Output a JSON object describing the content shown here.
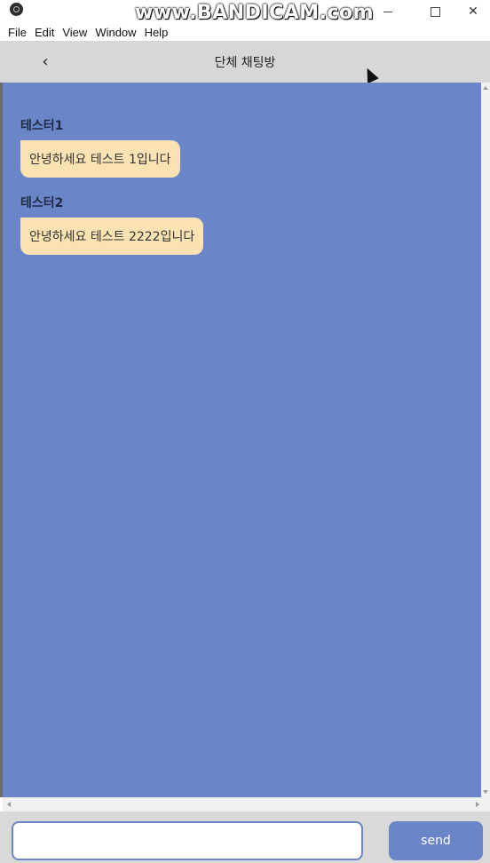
{
  "window": {
    "watermark": "www.BANDICAM.com"
  },
  "menu": [
    "File",
    "Edit",
    "View",
    "Window",
    "Help"
  ],
  "header": {
    "back_icon": "‹",
    "title": "단체 채팅방"
  },
  "messages": [
    {
      "sender": "테스터1",
      "text": "안녕하세요 테스트 1입니다"
    },
    {
      "sender": "테스터2",
      "text": "안녕하세요 테스트 2222입니다"
    }
  ],
  "composer": {
    "input_value": "",
    "send_label": "send"
  },
  "colors": {
    "chat_background": "#6a86c8",
    "bubble": "#fbe2b2",
    "header_background": "#d7d7d7",
    "send_button": "#6a86c8"
  }
}
